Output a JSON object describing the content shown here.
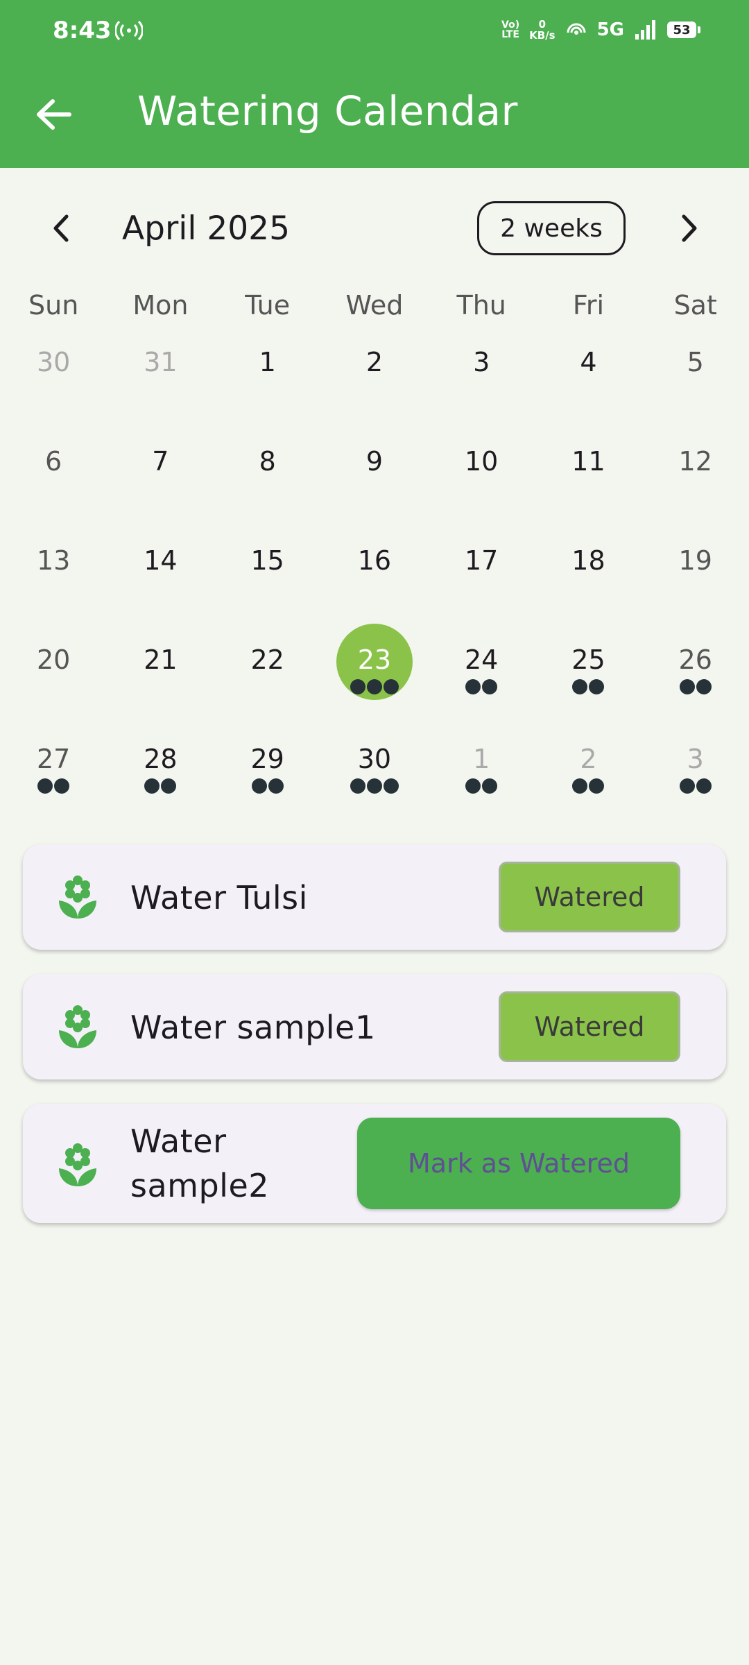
{
  "status_bar": {
    "time": "8:43",
    "volte": "Vo\nLTE",
    "net_speed_value": "0",
    "net_speed_unit": "KB/s",
    "network": "5G",
    "battery": "53"
  },
  "app_bar": {
    "title": "Watering Calendar",
    "back_icon": "arrow-back-icon",
    "color": "#4caf50"
  },
  "calendar": {
    "month_label": "April 2025",
    "format_button": "2 weeks",
    "days_of_week": [
      "Sun",
      "Mon",
      "Tue",
      "Wed",
      "Thu",
      "Fri",
      "Sat"
    ],
    "selected_color": "#8bc34a",
    "marker_color": "#263238",
    "weeks": [
      [
        {
          "d": "30",
          "outside": true,
          "m": 0
        },
        {
          "d": "31",
          "outside": true,
          "m": 0
        },
        {
          "d": "1",
          "m": 0
        },
        {
          "d": "2",
          "m": 0
        },
        {
          "d": "3",
          "m": 0
        },
        {
          "d": "4",
          "m": 0
        },
        {
          "d": "5",
          "m": 0
        }
      ],
      [
        {
          "d": "6",
          "m": 0
        },
        {
          "d": "7",
          "m": 0
        },
        {
          "d": "8",
          "m": 0
        },
        {
          "d": "9",
          "m": 0
        },
        {
          "d": "10",
          "m": 0
        },
        {
          "d": "11",
          "m": 0
        },
        {
          "d": "12",
          "m": 0
        }
      ],
      [
        {
          "d": "13",
          "m": 0
        },
        {
          "d": "14",
          "m": 0
        },
        {
          "d": "15",
          "m": 0
        },
        {
          "d": "16",
          "m": 0
        },
        {
          "d": "17",
          "m": 0
        },
        {
          "d": "18",
          "m": 0
        },
        {
          "d": "19",
          "m": 0
        }
      ],
      [
        {
          "d": "20",
          "m": 0
        },
        {
          "d": "21",
          "m": 0
        },
        {
          "d": "22",
          "m": 0
        },
        {
          "d": "23",
          "m": 3,
          "selected": true
        },
        {
          "d": "24",
          "m": 2
        },
        {
          "d": "25",
          "m": 2
        },
        {
          "d": "26",
          "m": 2
        }
      ],
      [
        {
          "d": "27",
          "m": 2
        },
        {
          "d": "28",
          "m": 2
        },
        {
          "d": "29",
          "m": 2
        },
        {
          "d": "30",
          "m": 3
        },
        {
          "d": "1",
          "outside": true,
          "m": 2
        },
        {
          "d": "2",
          "outside": true,
          "m": 2
        },
        {
          "d": "3",
          "outside": true,
          "m": 2
        }
      ]
    ]
  },
  "tasks": [
    {
      "label": "Water Tulsi",
      "button": "Watered",
      "icon": "flower-icon",
      "done": true
    },
    {
      "label": "Water sample1",
      "button": "Watered",
      "icon": "flower-icon",
      "done": true
    },
    {
      "label_line1": "Water",
      "label_line2": "sample2",
      "button": "Mark as Watered",
      "icon": "flower-icon",
      "done": false
    }
  ]
}
